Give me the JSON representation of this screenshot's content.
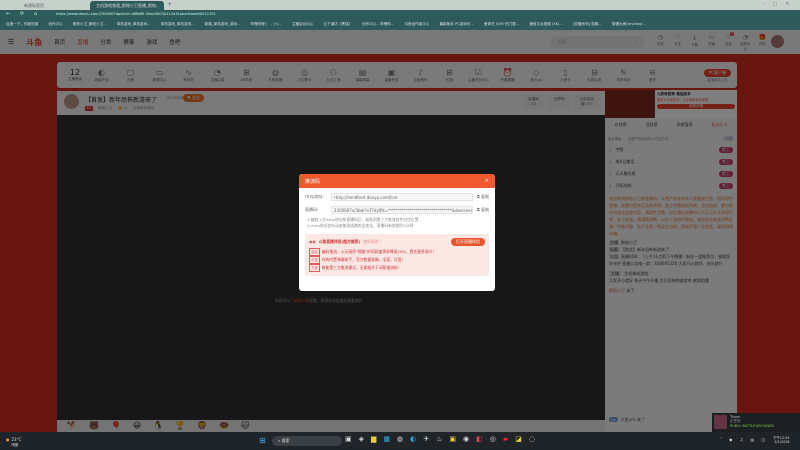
{
  "browser": {
    "tabs": [
      {
        "label": "新建标签页"
      },
      {
        "label": "主机游戏频道_斯帕小卫直播_斯帕..."
      }
    ],
    "new_tab": "+",
    "url": "https://www.douyu.com/2300007dpshell=4f8b89-30ed3003A112a31okxd2oad00011701",
    "bookmarks": [
      "百度一下，你就知道",
      "创作中心",
      "斯帕小卫_斯帕小卫...",
      "单机游戏_单机游戏...",
      "单机游戏_单机游戏...",
      "新闻_单机游戏_游戏...",
      "哔哩哔哩 ( ˙-˙)つ...",
      "主播后台中心",
      "云下道坊《黑铭》",
      "创作中心 - 哔哩哔...",
      "抖音创作者中心",
      "最新版本 PC游戏可...",
      "爱奇艺 iQIYI·热门剧...",
      "通信平台视频 (4K)...",
      "[双播系列] 剪辑...",
      "剪辑大师(revideo)..."
    ]
  },
  "site": {
    "logo": "斗鱼",
    "nav": [
      "首页",
      "直播",
      "分类",
      "赛事",
      "游戏",
      "鱼吧"
    ],
    "search_placeholder": "搜索",
    "header_icons": [
      "历史",
      "关注",
      "下载",
      "开播",
      "消息",
      "创作中心",
      "任务"
    ],
    "message_badge": "1"
  },
  "category_bar": {
    "level": "12",
    "level_label": "主播等级",
    "items": [
      "超级开关",
      "月榜",
      "数据中心",
      "狗日好",
      "主播口袋",
      "AR礼物",
      "礼物权限",
      "刀剑神卡",
      "互动工具",
      "弹幕屏幕",
      "直播任务",
      "正版音乐",
      "礼物",
      "主播任务中心",
      "开播提醒",
      "鱼丸vip",
      "万田卡",
      "礼物心愿",
      "发布动态",
      "更多"
    ],
    "pc_button": "PC客户端",
    "pc_sub": "直播助手上线"
  },
  "stream": {
    "title": "【首发】新年恐怖新游来了",
    "room_id": "8873986",
    "follow": "关注",
    "streamer": "斯帕小卫",
    "likes": "11",
    "category": "主机单机游戏",
    "level_badge": "LV",
    "tabs": [
      {
        "label": "直播间",
        "sub": "2/3"
      },
      {
        "label": "全屏网"
      },
      {
        "label": "火箭加成",
        "sub": "赠10个"
      }
    ],
    "notice_prefix": "你还可以",
    "notice_link": "下载客户端",
    "notice_suffix": "观看，获得纯净极速的观看体验"
  },
  "ad": {
    "title": "九影奇剧录·最佳版本",
    "sub": "爆发行全部登场！九影奇剧录全部限...",
    "tag": "广告",
    "button": "查看详情"
  },
  "rank": {
    "tabs": [
      "在线榜",
      "活跃榜",
      "贡献值榜",
      "粉丝打卡"
    ],
    "filter": "最近等级",
    "sort": "火箭",
    "desc": "主播严禁未成年人内容打赏",
    "users": [
      {
        "name": "宇智·",
        "badge": "斯卫"
      },
      {
        "name": "狗X且趣话",
        "badge": "斯卫"
      },
      {
        "name": "天天看吃卷",
        "badge": "斯卫"
      },
      {
        "name": "开拓的狗",
        "badge": "斯卫"
      }
    ]
  },
  "chat": {
    "system": "欢迎来到斯帕小卫的直播间。斗鱼严禁未成年人直播或打赏。倡导绿色直播，直播内容和互动须文明，禁止传播低俗色情、违法违规、暴力等任何违法违规内容。请理性消费，如主播在直播中以不正当方式诱导打赏、私下交易，请谨慎判断，以防人身财产损失。请勿轻信各类招聘征婚、代练代聊、私下交易、购买礼包码、游戏币等广告信息，谨防网络诈骗。",
    "info": [
      {
        "label": "主播",
        "value": "斯帕小卫"
      },
      {
        "label": "标题",
        "value": "【首发】新年恐怖新游来了"
      },
      {
        "label": "公告",
        "value": "直播时间：（上午11点到下午晚播）粉丝一组推荐位，感恩您的守护 直播公告唯一群：458095320 大家开心就好，快乐就行"
      }
    ],
    "anchor_badge": "主播",
    "anchor_tag": "主机单机游戏",
    "anchor_msg": "大家开心就好 每天中午开播 主打恐怖刺激游戏 感恩相遇",
    "enter1_user": "斯帕小卫",
    "enter1_suffix": "来了",
    "enter2": "大思ych 来了"
  },
  "modal": {
    "title": "推流码",
    "close": "×",
    "rtmp_label": "rtmp地址:",
    "rtmp_value": "rtmp://sendtnet.douyu.com/live",
    "code_label": "直播码:",
    "code_value": "2300007v/3bdr?vT?dyfRt=********************************&deviceengineation=0",
    "copy": "复制",
    "tips": [
      "1.复制上方rtmp地址和直播码后，粘贴到第三方推流软件对应位置",
      "2.rtmp地址仅在动态推流成路的全变化，直播码有效期为5分钟"
    ],
    "promo_title": "斗鱼直播伴侣(超方推荐)",
    "promo_link": "使用说明 ›",
    "open_button": "打开直播伴侣",
    "promo_lines": [
      {
        "tag": "高能",
        "text": "编码推流，火元画质\"频路\"的同网速需求降低20%，提任更多观众！"
      },
      {
        "tag": "可靠",
        "text": "你的内置弹幕助手，官方数据准确，全面，可靠！"
      },
      {
        "tag": "方便",
        "text": "做能第三方推流模式，无需相关于动帮推流码！"
      }
    ]
  },
  "taskbar": {
    "weather": "23°C",
    "weather_sub": "晴朗",
    "search": "搜索",
    "time": "下午12:25",
    "date": "2/1/2026",
    "notif_name": "Thorn",
    "notif_status": "正在玩",
    "notif_game": "PUBG: BATTLEGROUNDS"
  }
}
